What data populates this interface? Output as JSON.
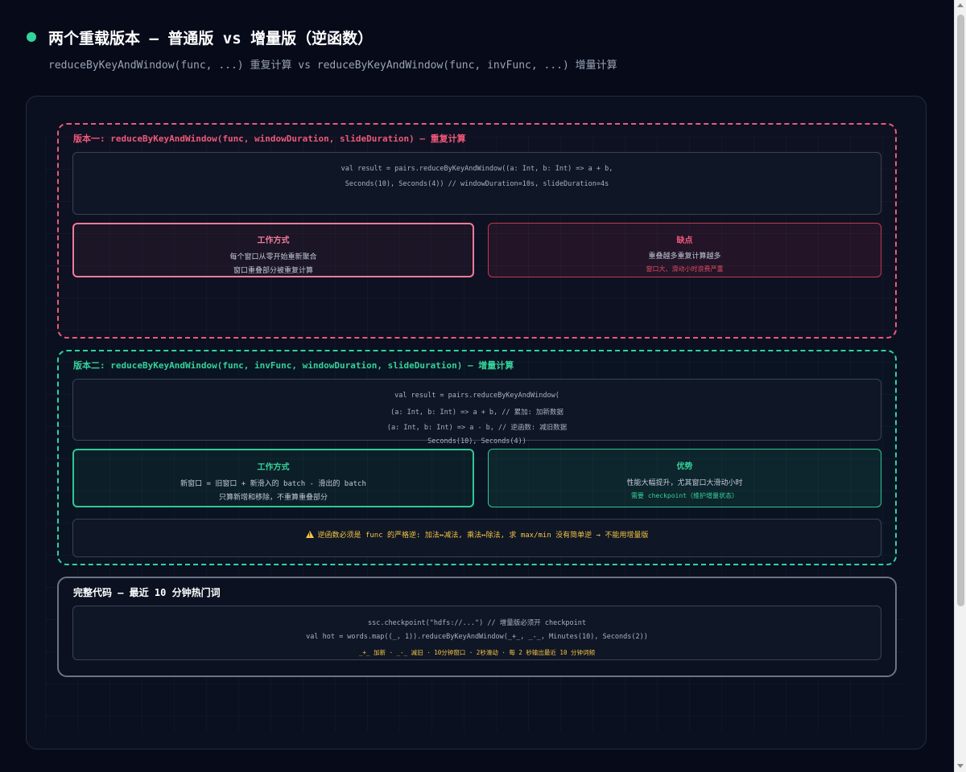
{
  "header": {
    "title": "两个重载版本 — 普通版 vs 增量版（逆函数）",
    "subtitle": "reduceByKeyAndWindow(func, ...) 重复计算 vs reduceByKeyAndWindow(func, invFunc, ...) 增量计算"
  },
  "version1": {
    "title": "版本一: reduceByKeyAndWindow(func, windowDuration, slideDuration) — 重复计算",
    "code": [
      "val result = pairs.reduceByKeyAndWindow((a: Int, b: Int) => a + b,",
      "Seconds(10), Seconds(4)) // windowDuration=10s, slideDuration=4s"
    ],
    "how": {
      "title": "工作方式",
      "lines": [
        "每个窗口从零开始重新聚合",
        "窗口重叠部分被重复计算"
      ]
    },
    "cons": {
      "title": "缺点",
      "line": "重叠越多重复计算越多",
      "note": "窗口大、滑动小时浪费严重"
    }
  },
  "version2": {
    "title": "版本二: reduceByKeyAndWindow(func, invFunc, windowDuration, slideDuration) — 增量计算",
    "code": [
      "val result = pairs.reduceByKeyAndWindow(",
      "(a: Int, b: Int) => a + b, // 累加: 加新数据",
      "(a: Int, b: Int) => a - b, // 逆函数: 减旧数据",
      "Seconds(10), Seconds(4))"
    ],
    "how": {
      "title": "工作方式",
      "lines": [
        "新窗口 = 旧窗口 + 新滑入的 batch - 滑出的 batch",
        "只算新增和移除，不重算重叠部分"
      ]
    },
    "pros": {
      "title": "优势",
      "line": "性能大幅提升，尤其窗口大滑动小时",
      "note": "需要 checkpoint（维护增量状态）"
    },
    "warning": "逆函数必须是 func 的严格逆: 加法↔减法, 乘法↔除法, 求 max/min 没有简单逆 → 不能用增量版"
  },
  "full_code": {
    "title": "完整代码 — 最近 10 分钟热门词",
    "lines": [
      "ssc.checkpoint(\"hdfs://...\") // 增量版必须开 checkpoint",
      "val hot = words.map((_, 1)).reduceByKeyAndWindow(_+_, _-_, Minutes(10), Seconds(2))"
    ],
    "note": "_+_ 加新 · _-_ 减旧 · 10分钟窗口 · 2秒滑动 · 每 2 秒输出最近 10 分钟词频"
  },
  "colors": {
    "background": "#060a19",
    "red_accent": "#f0587a",
    "green_accent": "#34d399",
    "warning": "#f5c542"
  }
}
